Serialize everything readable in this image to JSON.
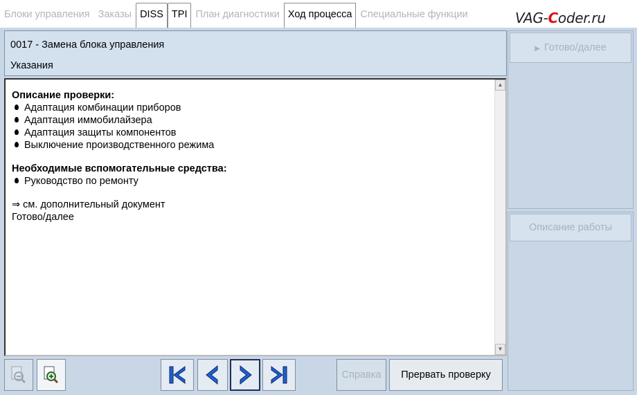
{
  "tabs": [
    {
      "label": "Блоки управления",
      "state": "disabled"
    },
    {
      "label": "Заказы",
      "state": "disabled"
    },
    {
      "label": "DISS",
      "state": "enabled"
    },
    {
      "label": "TPI",
      "state": "enabled"
    },
    {
      "label": "План диагностики",
      "state": "disabled"
    },
    {
      "label": "Ход процесса",
      "state": "active"
    },
    {
      "label": "Специальные функции",
      "state": "disabled"
    }
  ],
  "logo": {
    "pre": "VAG-",
    "accent": "C",
    "post": "oder.ru"
  },
  "procedure": {
    "title": "0017 - Замена блока управления",
    "subtitle": "Указания"
  },
  "content": {
    "check_heading": "Описание проверки:",
    "check_items": [
      "Адаптация комбинации приборов",
      "Адаптация иммобилайзера",
      "Адаптация защиты компонентов",
      "Выключение производственного режима"
    ],
    "aids_heading": "Необходимые вспомогательные средства:",
    "aids_items": [
      "Руководство по ремонту"
    ],
    "doc_link": "⇒ см. дополнительный документ",
    "footer_line": "Готово/далее"
  },
  "side": {
    "ready_label": "Готово/далее",
    "ready_icon": "play-triangle-icon",
    "desc_label": "Описание работы"
  },
  "toolbar": {
    "help_label": "Справка",
    "abort_label": "Прервать проверку"
  },
  "colors": {
    "nav_blue": "#1f5fd0",
    "panel_bg": "#c8d6e6",
    "header_bg": "#d3e1ef"
  }
}
